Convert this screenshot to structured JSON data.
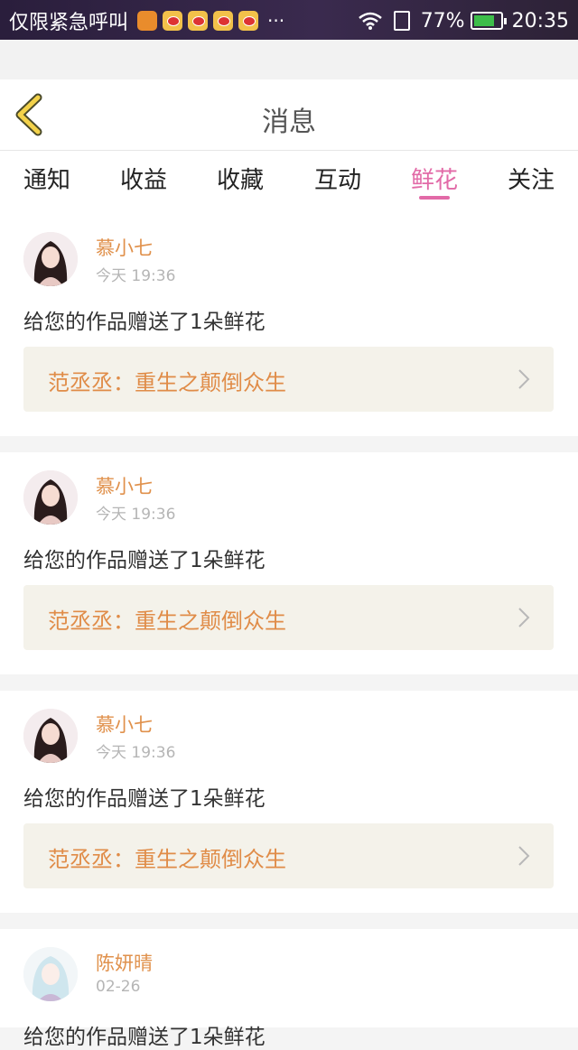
{
  "status_bar": {
    "carrier": "仅限紧急呼叫",
    "more": "···",
    "battery_percent": "77%",
    "battery_level": 0.77,
    "time": "20:35",
    "icons": [
      "uc-browser-icon",
      "weibo-icon",
      "weibo-icon",
      "weibo-icon",
      "weibo-icon",
      "wifi-icon",
      "sim-icon",
      "battery-icon"
    ]
  },
  "nav": {
    "title": "消息",
    "back_icon": "chevron-left-icon"
  },
  "tabs": [
    {
      "label": "通知",
      "active": false
    },
    {
      "label": "收益",
      "active": false
    },
    {
      "label": "收藏",
      "active": false
    },
    {
      "label": "互动",
      "active": false
    },
    {
      "label": "鲜花",
      "active": true
    },
    {
      "label": "关注",
      "active": false
    }
  ],
  "items": [
    {
      "user": "慕小七",
      "time": "今天 19:36",
      "message": "给您的作品赠送了1朵鲜花",
      "work_author": "范丞丞",
      "work_title": "：重生之颠倒众生"
    },
    {
      "user": "慕小七",
      "time": "今天 19:36",
      "message": "给您的作品赠送了1朵鲜花",
      "work_author": "范丞丞",
      "work_title": "：重生之颠倒众生"
    },
    {
      "user": "慕小七",
      "time": "今天 19:36",
      "message": "给您的作品赠送了1朵鲜花",
      "work_author": "范丞丞",
      "work_title": "：重生之颠倒众生"
    },
    {
      "user": "陈妍晴",
      "time": "02-26",
      "message": "给您的作品赠送了1朵鲜花"
    }
  ],
  "colors": {
    "accent_pink": "#e26aa7",
    "username_orange": "#e0914c",
    "work_bg": "#f4f2ea",
    "back_yellow": "#f3d24a"
  }
}
